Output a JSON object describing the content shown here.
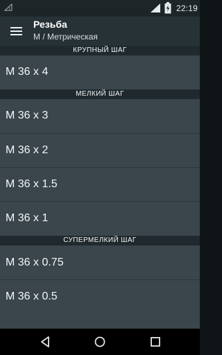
{
  "status_bar": {
    "time": "22:19",
    "icons": [
      "notification-icon",
      "wifi-icon",
      "battery-charging-icon"
    ]
  },
  "app_bar": {
    "title": "Резьба",
    "subtitle": "М / Метрическая",
    "menu_icon": "hamburger-menu-icon"
  },
  "sections": [
    {
      "header": "КРУПНЫЙ ШАГ",
      "items": [
        "M 36 x 4"
      ]
    },
    {
      "header": "МЕЛКИЙ ШАГ",
      "items": [
        "M 36 x 3",
        "M 36 x 2",
        "M 36 x 1.5",
        "M 36 x 1"
      ]
    },
    {
      "header": "СУПЕРМЕЛКИЙ ШАГ",
      "items": [
        "M 36 x 0.75",
        "M 36 x 0.5"
      ]
    }
  ],
  "nav_bar": {
    "buttons": [
      "back-icon",
      "home-icon",
      "recents-icon"
    ]
  },
  "colors": {
    "status_bar": "#1d2529",
    "app_bar": "#273237",
    "list_background": "#3a464c",
    "section_header": "#202a2e",
    "text": "#f4f7f8"
  }
}
